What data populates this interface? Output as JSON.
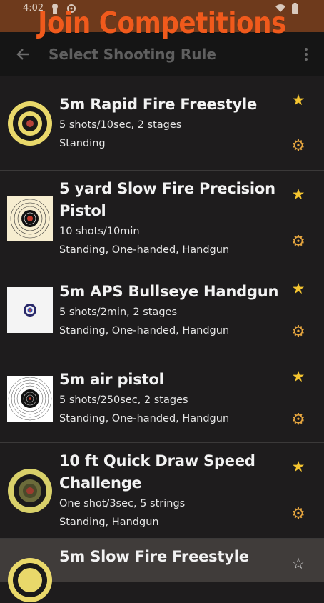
{
  "status_bar": {
    "time": "4:02"
  },
  "promo_banner": {
    "text": "Join Competitions"
  },
  "app_bar": {
    "title": "Select Shooting Rule"
  },
  "colors": {
    "accent": "#f05a1c",
    "star": "#f4c430",
    "gear": "#e7a63f",
    "background": "#1e1c1d"
  },
  "rules": [
    {
      "name": "5m Rapid Fire Freestyle",
      "shots": "5 shots/10sec, 2 stages",
      "position": "Standing",
      "favorite": true
    },
    {
      "name": "5 yard Slow Fire Precision Pistol",
      "shots": "10 shots/10min",
      "position": "Standing, One-handed, Handgun",
      "favorite": true
    },
    {
      "name": "5m APS Bullseye Handgun",
      "shots": "5 shots/2min, 2 stages",
      "position": "Standing, One-handed, Handgun",
      "favorite": true
    },
    {
      "name": "5m air pistol",
      "shots": "5 shots/250sec, 2 stages",
      "position": "Standing, One-handed, Handgun",
      "favorite": true
    },
    {
      "name": "10 ft Quick Draw Speed Challenge",
      "shots": "One shot/3sec, 5 strings",
      "position": "Standing, Handgun",
      "favorite": true
    },
    {
      "name": "5m Slow Fire Freestyle",
      "favorite": false
    }
  ]
}
